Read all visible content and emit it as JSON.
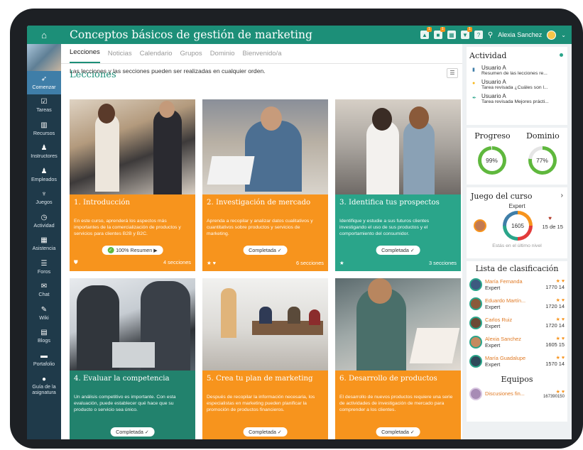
{
  "app": {
    "course_title": "Conceptos básicos de gestión de marketing",
    "user_name": "Alexia Sanchez",
    "accent_color": "#1c8f78",
    "icons": [
      "home-icon",
      "bell-icon",
      "gift-icon",
      "grid-icon",
      "cart-icon",
      "help-icon",
      "search-icon",
      "chevron-down-icon"
    ],
    "badges": [
      "1",
      "1",
      "1"
    ]
  },
  "sidebar": {
    "items": [
      {
        "label": "Comenzar",
        "icon": "➶"
      },
      {
        "label": "Tareas",
        "icon": "☑"
      },
      {
        "label": "Recursos",
        "icon": "▥"
      },
      {
        "label": "Instructores",
        "icon": "♟"
      },
      {
        "label": "Empleados",
        "icon": "♟"
      },
      {
        "label": "Juegos",
        "icon": "♆"
      },
      {
        "label": "Actividad",
        "icon": "◷"
      },
      {
        "label": "Asistencia",
        "icon": "▦"
      },
      {
        "label": "Foros",
        "icon": "☰"
      },
      {
        "label": "Chat",
        "icon": "✉"
      },
      {
        "label": "Wiki",
        "icon": "✎"
      },
      {
        "label": "Blogs",
        "icon": "▤"
      },
      {
        "label": "Portafolio",
        "icon": "▬"
      },
      {
        "label": "Guía de la asignatura",
        "icon": "●"
      }
    ]
  },
  "tabs": [
    "Lecciones",
    "Noticias",
    "Calendario",
    "Grupos",
    "Dominio",
    "Bienvenido/a"
  ],
  "lessons": {
    "title": "Lecciones",
    "subtitle": "Las lecciones y las secciones pueden ser realizadas en cualquier orden.",
    "cards": [
      {
        "title": "1. Introducción",
        "desc": "En este curso, aprenderá los aspectos más importantes de la comercialización de productos y servicios para clientes B2B y B2C.",
        "pill": "100% Resumen ▶",
        "footer_left": "⛊",
        "footer_right": "4 secciones"
      },
      {
        "title": "2. Investigación de mercado",
        "desc": "Aprenda a recopilar y analizar datos cualitativos y cuantitativos sobre productos y servicios de marketing.",
        "pill": "Completada ✓",
        "footer_left": "★ ♥",
        "footer_right": "6 secciones"
      },
      {
        "title": "3. Identifica tus prospectos",
        "desc": "Identifique y estudie a sus futuros clientes investigando el uso de sus productos y el comportamiento del consumidor.",
        "pill": "Completada ✓",
        "footer_left": "★",
        "footer_right": "3 secciones"
      },
      {
        "title": "4. Evaluar la competencia",
        "desc": "Un análisis competitivo es importante. Con esta evaluación, puede establecer qué hace que su producto o servicio sea único.",
        "pill": "Completada ✓",
        "footer_left": "",
        "footer_right": ""
      },
      {
        "title": "5. Crea tu plan de marketing",
        "desc": "Después de recopilar la información necesaria, los especialistas en marketing pueden planificar la promoción de productos financieros.",
        "pill": "Completada ✓",
        "footer_left": "",
        "footer_right": ""
      },
      {
        "title": "6. Desarrollo de productos",
        "desc": "El desarrollo de nuevos productos requiere una serie de actividades de investigación de mercado para comprender a los clientes.",
        "pill": "Completada ✓",
        "footer_left": "",
        "footer_right": ""
      }
    ]
  },
  "activity": {
    "title": "Actividad",
    "items": [
      {
        "user": "Usuario A",
        "text": "Resumen de las lecciones re..."
      },
      {
        "user": "Usuario A",
        "text": "Tarea revisada ¿Cuáles son l..."
      },
      {
        "user": "Usuario A",
        "text": "Tarea revisada Mejores prácti..."
      }
    ]
  },
  "progress": {
    "label": "Progreso",
    "value": "99%",
    "fraction": 0.99
  },
  "mastery": {
    "label": "Dominio",
    "value": "77%",
    "fraction": 0.77
  },
  "game": {
    "title": "Juego del curso",
    "level": "Expert",
    "points": "1605",
    "rank": "15 de 15",
    "note": "Estás en el último nivel"
  },
  "leaderboard": {
    "title": "Lista de clasificación",
    "rows": [
      {
        "name": "María Fernanda",
        "level": "Expert",
        "score": "1770 14"
      },
      {
        "name": "Eduardo Martín...",
        "level": "Expert",
        "score": "1720 14"
      },
      {
        "name": "Carlos Ruiz",
        "level": "Expert",
        "score": "1720 14"
      },
      {
        "name": "Alexia Sanchez",
        "level": "Expert",
        "score": "1605 15"
      },
      {
        "name": "María Guadalupe",
        "level": "Expert",
        "score": "1570 14"
      }
    ]
  },
  "teams": {
    "title": "Equipos",
    "name": "Discusiones fin...",
    "score": "167390150"
  }
}
